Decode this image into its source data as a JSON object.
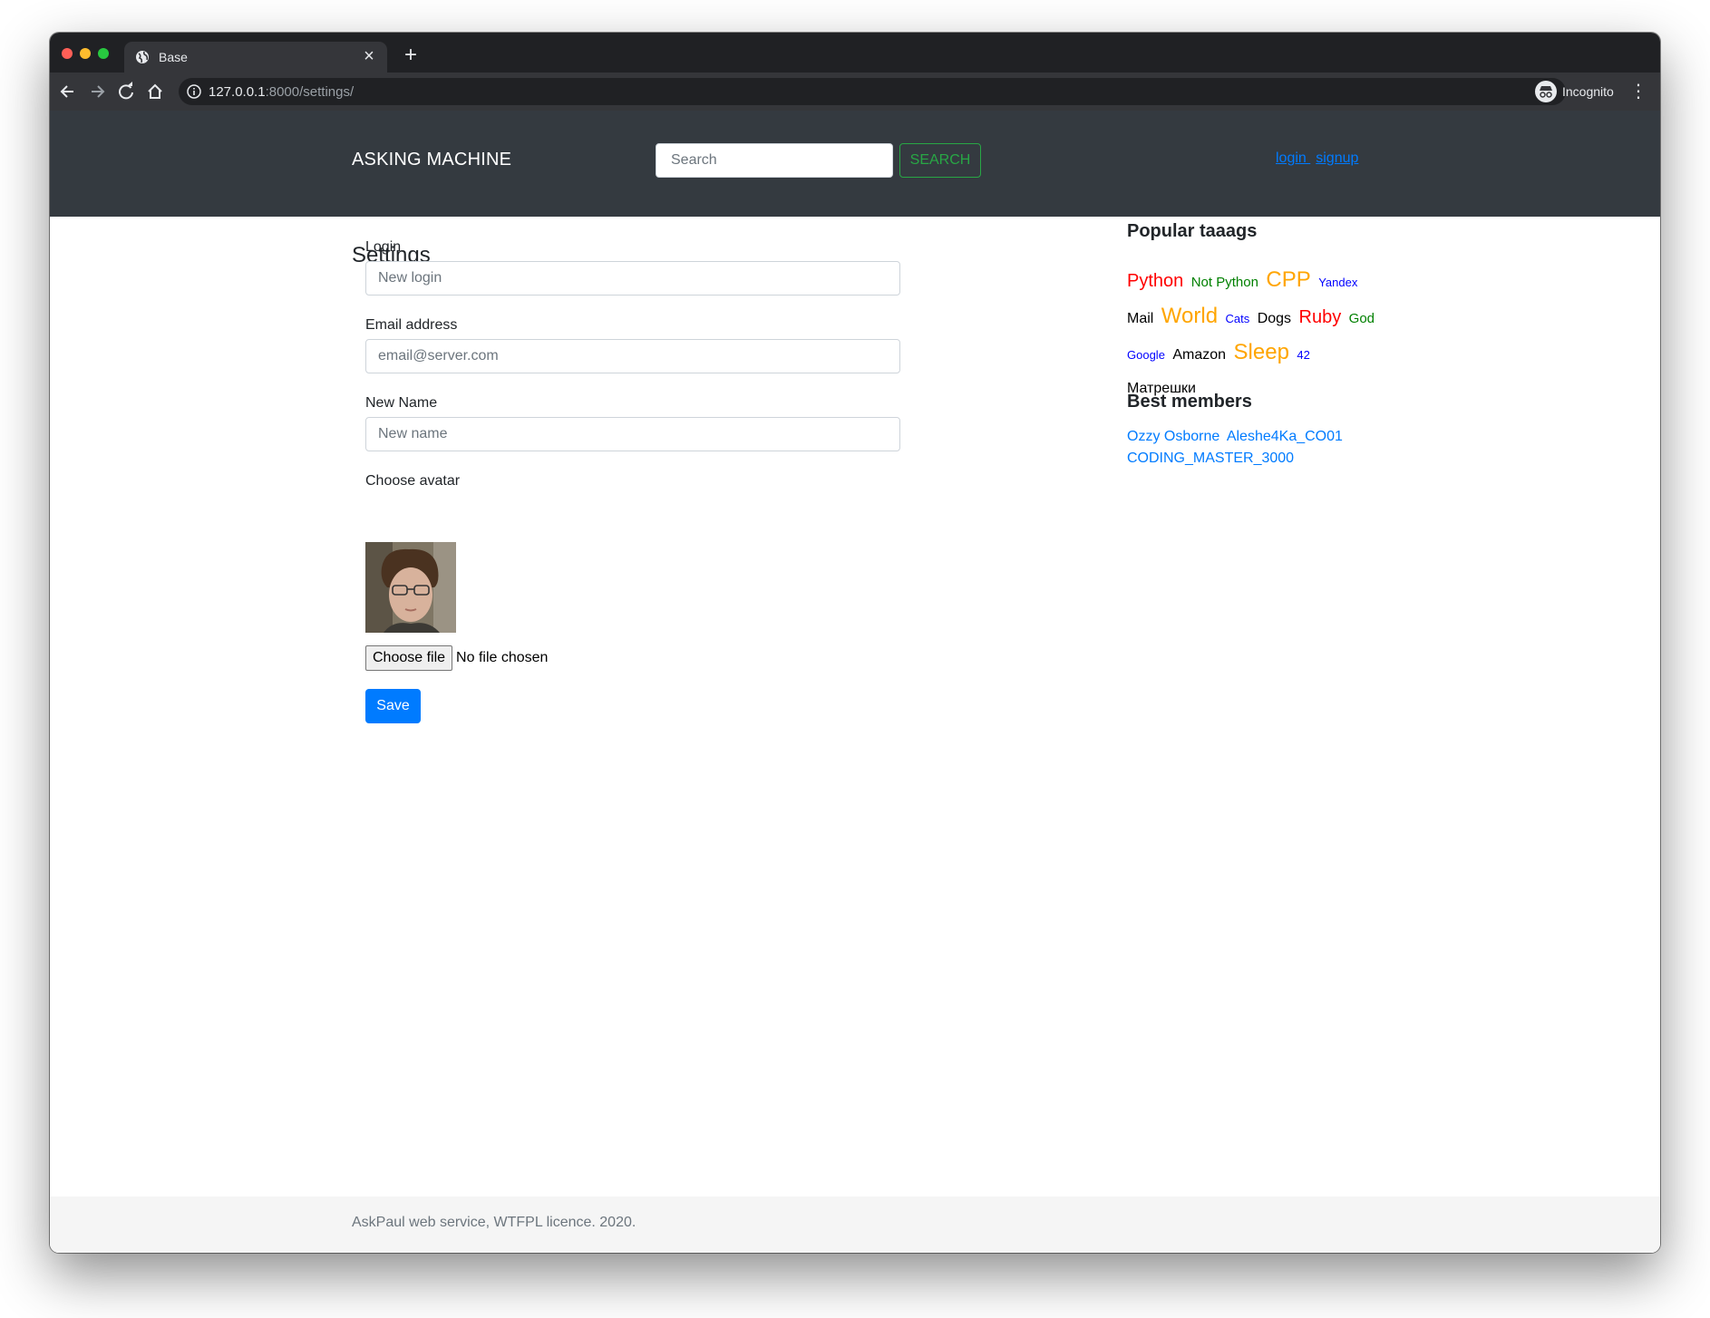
{
  "browser": {
    "tab_title": "Base",
    "url_host": "127.0.0.1",
    "url_path": ":8000/settings/",
    "profile_label": "Incognito"
  },
  "header": {
    "brand": "ASKING MACHINE",
    "search_placeholder": "Search",
    "search_button": "SEARCH",
    "login_link": "login ",
    "signup_link": "signup"
  },
  "settings": {
    "title": "Settings",
    "login_label": "Login",
    "login_placeholder": "New login",
    "email_label": "Email address",
    "email_placeholder": "email@server.com",
    "name_label": "New Name",
    "name_placeholder": "New name",
    "avatar_label": "Choose avatar",
    "file_button": "Choose file",
    "file_status": "No file chosen",
    "save_button": "Save"
  },
  "sidebar": {
    "tags_title": "Popular taaags",
    "tags": [
      {
        "label": "Python",
        "color": "#ff0000",
        "size": "large"
      },
      {
        "label": "Not Python",
        "color": "#008000",
        "size": "small"
      },
      {
        "label": "CPP",
        "color": "#ffa500",
        "size": "xlarge"
      },
      {
        "label": "Yandex",
        "color": "#0000ff",
        "size": "xsmall"
      },
      {
        "label": "Mail",
        "color": "#000000",
        "size": "medium"
      },
      {
        "label": "World",
        "color": "#ffa500",
        "size": "xlarge"
      },
      {
        "label": "Cats",
        "color": "#0000ff",
        "size": "xsmall"
      },
      {
        "label": "Dogs",
        "color": "#000000",
        "size": "medium"
      },
      {
        "label": "Ruby",
        "color": "#ff0000",
        "size": "large"
      },
      {
        "label": "God",
        "color": "#008000",
        "size": "small"
      },
      {
        "label": "Google",
        "color": "#0000ff",
        "size": "xsmall"
      },
      {
        "label": "Amazon",
        "color": "#000000",
        "size": "medium"
      },
      {
        "label": "Sleep",
        "color": "#ffa500",
        "size": "xlarge"
      },
      {
        "label": "42",
        "color": "#0000ff",
        "size": "xsmall"
      },
      {
        "label": "Матрешки",
        "color": "#000000",
        "size": "medium"
      }
    ],
    "members_title": "Best members",
    "members": [
      "Ozzy Osborne",
      "Aleshe4Ka_CO01",
      "CODING_MASTER_3000"
    ]
  },
  "footer": {
    "text": "AskPaul web service, WTFPL licence. 2020."
  }
}
